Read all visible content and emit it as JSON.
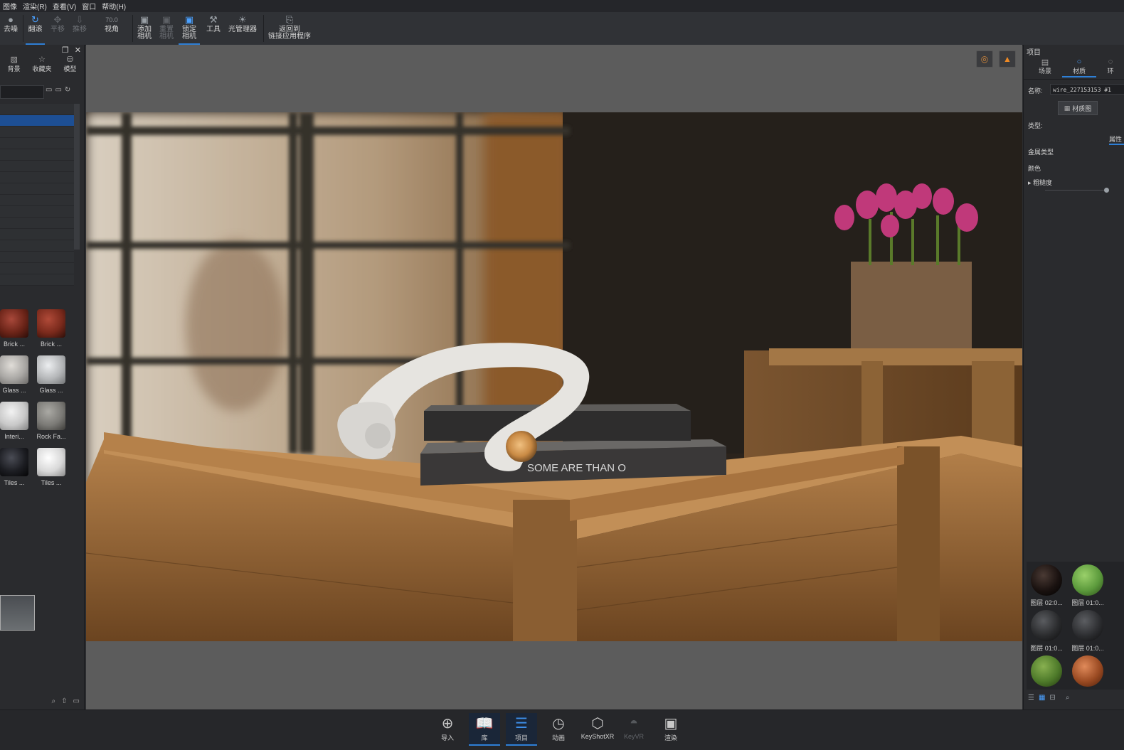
{
  "menu": [
    "图像",
    "渲染(R)",
    "查看(V)",
    "窗口",
    "帮助(H)"
  ],
  "toolbar": {
    "denoise": "去噪",
    "tumble": "翻滚",
    "pan": "平移",
    "dolly": "推移",
    "fov_value": "70.0",
    "fov": "视角",
    "add_camera": [
      "添加",
      "相机"
    ],
    "reset_camera": [
      "重置",
      "相机"
    ],
    "lock_camera": [
      "锁定",
      "相机"
    ],
    "tools": "工具",
    "light_manager": "光管理器",
    "return_app": [
      "返回到",
      "链接应用程序"
    ]
  },
  "library": {
    "tabs": [
      "背景",
      "收藏夹",
      "模型"
    ],
    "materials": [
      {
        "label": "Brick ...",
        "color": "#6b2418"
      },
      {
        "label": "Brick ...",
        "color": "#7a2a1c"
      },
      {
        "label": "Glass ...",
        "color": "#a9a7a4"
      },
      {
        "label": "Glass ...",
        "color": "#b4b6b8"
      },
      {
        "label": "Interi...",
        "color": "#c8c8c8"
      },
      {
        "label": "Rock Fa...",
        "color": "#7b7a76"
      },
      {
        "label": "Tiles ...",
        "color": "#1c1d22"
      },
      {
        "label": "Tiles ...",
        "color": "#d8d8d8"
      }
    ]
  },
  "project": {
    "title": "项目",
    "tabs": [
      "场景",
      "材质",
      "环"
    ],
    "name_label": "名称:",
    "name_value": "wire_227153153 #1",
    "material_graph": "材质图",
    "type_label": "类型:",
    "properties": "属性",
    "metal_type": "金属类型",
    "color": "颜色",
    "roughness": "粗糙度",
    "swatches": [
      {
        "label": "图层 02:0...",
        "color": "#1a1210"
      },
      {
        "label": "图层 01:0...",
        "color": "#5c9a3c"
      },
      {
        "label": "图层 01:0...",
        "color": "#2a2b2d"
      },
      {
        "label": "图层 01:0...",
        "color": "#2c2d30"
      },
      {
        "label": "",
        "color": "#4e7a2a"
      },
      {
        "label": "",
        "color": "#9a4a22"
      }
    ]
  },
  "bottom": {
    "import": "导入",
    "library": "库",
    "project": "项目",
    "animation": "动画",
    "keyshotxr": "KeyShotXR",
    "keyvr": "KeyVR",
    "render": "渲染"
  },
  "book_text": "SOME ARE THAN O"
}
